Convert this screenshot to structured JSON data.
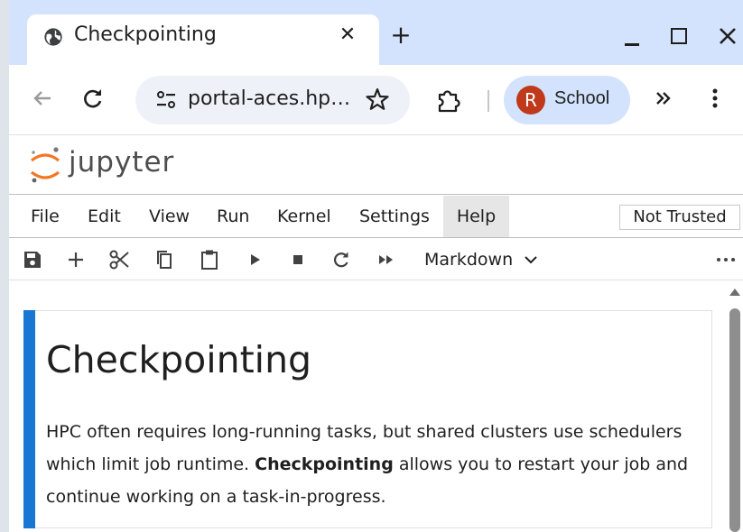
{
  "browser": {
    "tab_title": "Checkpointing",
    "close_tab_symbol": "✕",
    "new_tab_symbol": "+",
    "url": "portal-aces.hp…",
    "profile_initial": "R",
    "profile_label": "School",
    "icons": {
      "back": "arrow-left-icon",
      "reload": "reload-icon",
      "site_info": "tune-icon",
      "bookmark": "star-icon",
      "extensions": "puzzle-icon",
      "more_tools": "chevron-double-right-icon",
      "menu": "kebab-icon"
    },
    "colors": {
      "tabstrip": "#d3e3fd",
      "omnibox": "#eef2f8",
      "avatar": "#c0391b"
    }
  },
  "jupyter": {
    "logo_text": "jupyter",
    "menu": [
      "File",
      "Edit",
      "View",
      "Run",
      "Kernel",
      "Settings",
      "Help"
    ],
    "active_menu": "Help",
    "trust_status": "Not Trusted",
    "toolbar": {
      "cell_type": "Markdown",
      "buttons": [
        "save-icon",
        "add-cell-icon",
        "cut-icon",
        "copy-icon",
        "paste-icon",
        "run-icon",
        "stop-icon",
        "restart-icon",
        "fast-forward-icon"
      ]
    }
  },
  "cell": {
    "heading": "Checkpointing",
    "para_part1": "HPC often requires long-running tasks, but shared clusters use schedulers which limit job runtime. ",
    "para_bold": "Checkpointing",
    "para_part2": " allows you to restart your job and continue working on a task-in-progress.",
    "accent_color": "#1976d2"
  }
}
